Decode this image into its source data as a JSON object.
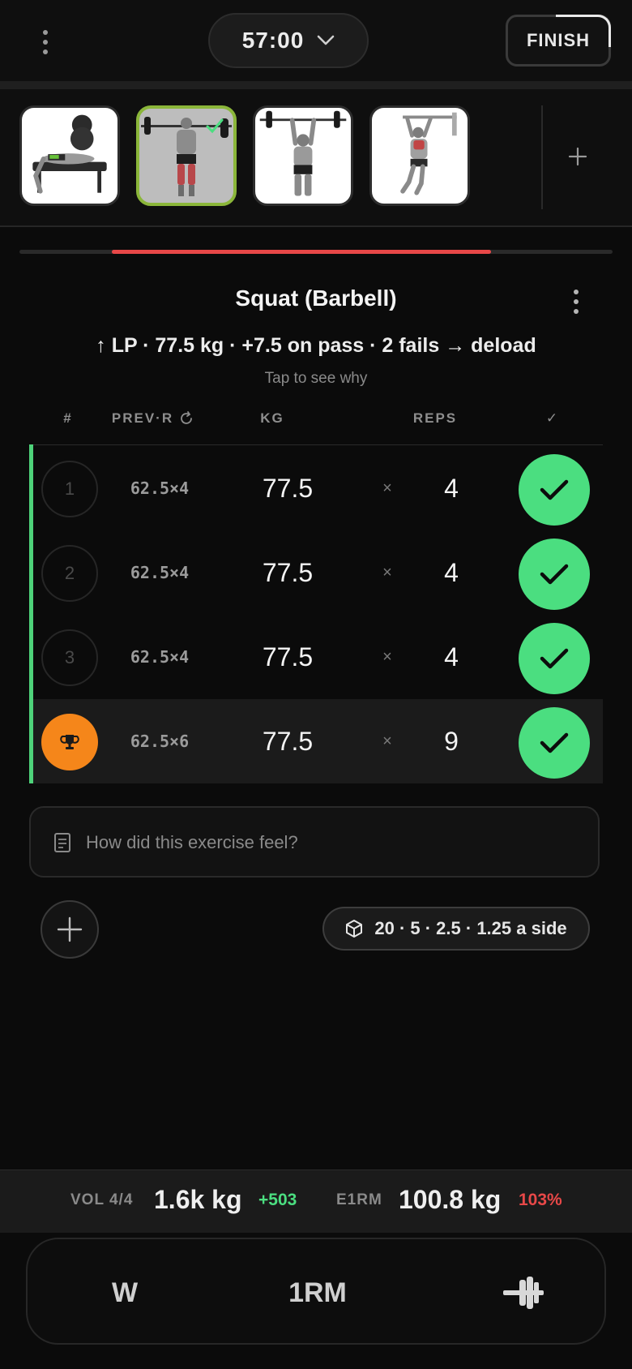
{
  "topbar": {
    "timer": "57:00",
    "finish_label": "FINISH"
  },
  "exercise_strip": {
    "thumbnails": [
      {
        "name": "bench-press-thumbnail",
        "active": false,
        "completed": false
      },
      {
        "name": "squat-thumbnail",
        "active": true,
        "completed": true
      },
      {
        "name": "overhead-press-thumbnail",
        "active": false,
        "completed": false
      },
      {
        "name": "pull-up-thumbnail",
        "active": false,
        "completed": false
      }
    ],
    "add_icon": "plus-icon"
  },
  "progress": {
    "fraction": 0.64,
    "color": "#e84848"
  },
  "exercise": {
    "title": "Squat (Barbell)",
    "rule": "↑ LP · 77.5 kg · +7.5 on pass · 2 fails → deload",
    "hint": "Tap to see why"
  },
  "table": {
    "headers": {
      "num": "#",
      "prev": "PREV·R",
      "kg": "KG",
      "reps": "REPS",
      "done": "✓"
    },
    "times_symbol": "×",
    "sets": [
      {
        "num": "1",
        "prev": "62.5×4",
        "kg": "77.5",
        "reps": "4",
        "done": true,
        "pr": false
      },
      {
        "num": "2",
        "prev": "62.5×4",
        "kg": "77.5",
        "reps": "4",
        "done": true,
        "pr": false
      },
      {
        "num": "3",
        "prev": "62.5×4",
        "kg": "77.5",
        "reps": "4",
        "done": true,
        "pr": false
      },
      {
        "num": "",
        "prev": "62.5×6",
        "kg": "77.5",
        "reps": "9",
        "done": true,
        "pr": true
      }
    ]
  },
  "notes": {
    "placeholder": "How did this exercise feel?"
  },
  "plates": {
    "label": "20 · 5 · 2.5 · 1.25 a side"
  },
  "stats": {
    "vol_label": "VOL 4/4",
    "vol_value": "1.6k kg",
    "vol_delta": "+503",
    "e1rm_label": "E1RM",
    "e1rm_value": "100.8 kg",
    "e1rm_pct": "103%"
  },
  "bottom_tabs": {
    "warmup": "W",
    "one_rm": "1RM",
    "plates_icon": "barbell-icon"
  },
  "colors": {
    "accent_green": "#4bde80",
    "danger_red": "#e84848",
    "pr_orange": "#f5861a",
    "active_border": "#8bb63a"
  }
}
